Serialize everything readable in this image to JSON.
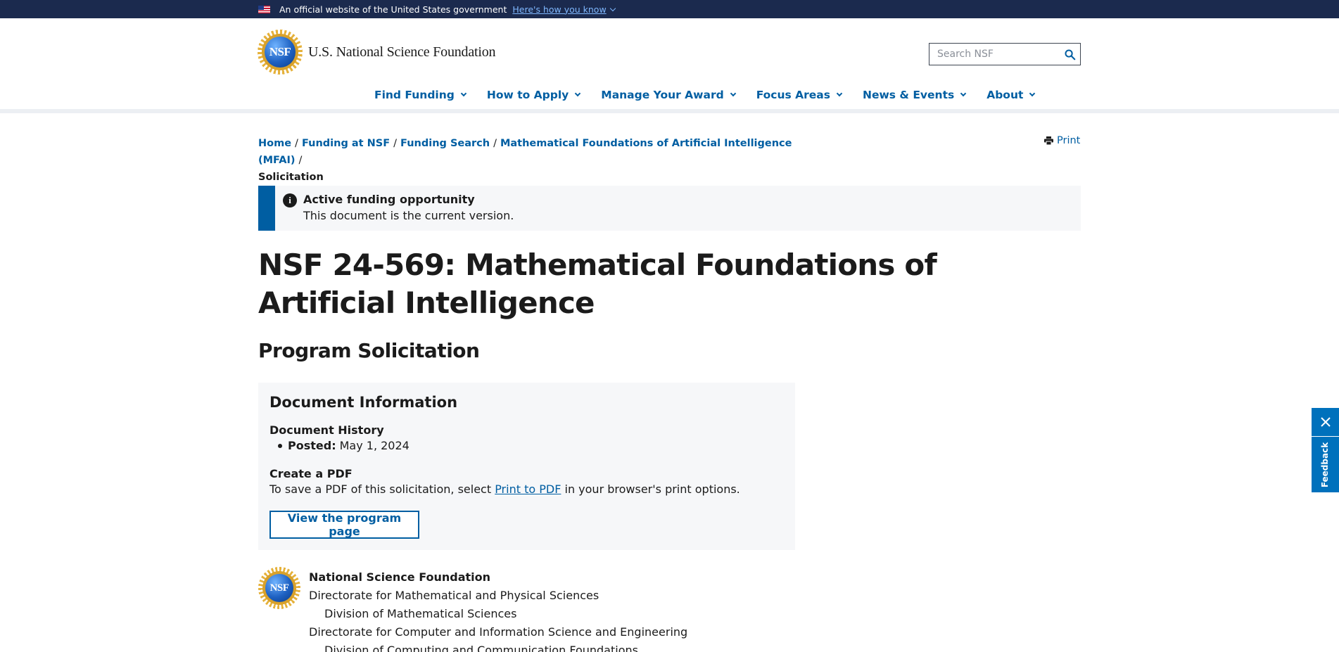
{
  "gov_banner": {
    "text": "An official website of the United States government",
    "link": "Here's how you know"
  },
  "header": {
    "logo_text": "NSF",
    "org_name": "U.S. National Science Foundation",
    "search_placeholder": "Search NSF"
  },
  "nav": {
    "items": [
      {
        "label": "Find Funding"
      },
      {
        "label": "How to Apply"
      },
      {
        "label": "Manage Your Award"
      },
      {
        "label": "Focus Areas"
      },
      {
        "label": "News & Events"
      },
      {
        "label": "About"
      }
    ]
  },
  "breadcrumb": {
    "items": [
      "Home",
      "Funding at NSF",
      "Funding Search",
      "Mathematical Foundations of Artificial Intelligence (MFAI)"
    ],
    "separator": "/",
    "current": "Solicitation"
  },
  "print_label": "Print",
  "alert": {
    "title": "Active funding opportunity",
    "body": "This document is the current version."
  },
  "page": {
    "title": "NSF 24-569: Mathematical Foundations of Artificial Intelligence",
    "subtitle": "Program Solicitation"
  },
  "document_info": {
    "heading": "Document Information",
    "history_label": "Document History",
    "posted_label": "Posted:",
    "posted_date": "May 1, 2024",
    "pdf_heading": "Create a PDF",
    "pdf_text_before": "To save a PDF of this solicitation, select ",
    "pdf_link": "Print to PDF",
    "pdf_text_after": " in your browser's print options.",
    "program_button": "View the program page"
  },
  "org_block": {
    "lines": [
      {
        "text": "National Science Foundation"
      },
      {
        "text": "Directorate for Mathematical and Physical Sciences"
      },
      {
        "text": "Division of Mathematical Sciences"
      },
      {
        "text": "Directorate for Computer and Information Science and Engineering"
      },
      {
        "text": "Division of Computing and Communication Foundations"
      }
    ]
  },
  "feedback": {
    "label": "Feedback"
  },
  "colors": {
    "primary": "#005ea2",
    "banner_bg": "#1b2a4e",
    "feedback": "#0071bc",
    "panel_bg": "#f6f7f9"
  }
}
